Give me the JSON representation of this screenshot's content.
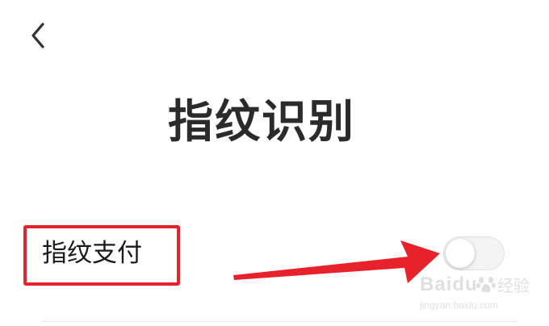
{
  "header": {
    "back_icon": "chevron-left-icon",
    "title": "指纹识别"
  },
  "settings": {
    "items": [
      {
        "label": "指纹支付",
        "toggle_state": "off"
      }
    ]
  },
  "annotations": {
    "highlight_color": "#e8222b",
    "arrow_color": "#e8222b"
  },
  "watermark": {
    "brand": "Baidu",
    "product": "经验",
    "url": "jingyan.baidu.com"
  }
}
